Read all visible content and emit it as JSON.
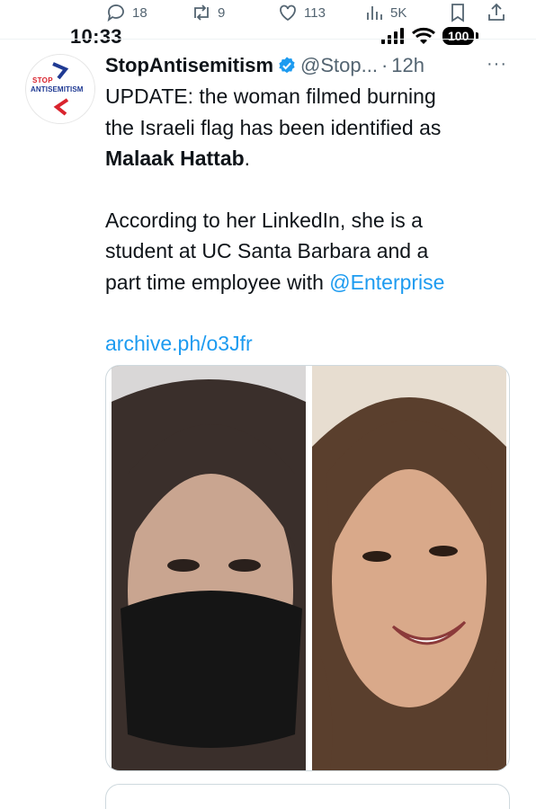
{
  "action_bar": {
    "reply_count": "18",
    "retweet_count": "9",
    "like_count": "113",
    "view_count": "5K",
    "icons": [
      "reply-icon",
      "retweet-icon",
      "heart-icon",
      "views-icon",
      "bookmark-icon",
      "share-icon"
    ]
  },
  "status_bar": {
    "time": "10:33",
    "battery": "100"
  },
  "tweet": {
    "author_name": "StopAntisemitism",
    "handle": "@Stop...",
    "separator": "·",
    "time_ago": "12h",
    "more": "···",
    "avatar": {
      "logo_line1": "STOP",
      "logo_line2": "ANTISEMITISM"
    },
    "text": {
      "line1": "UPDATE: the woman filmed burning",
      "line2": "the Israeli flag has been identified as",
      "bold_name": "Malaak Hattab",
      "bold_suffix": ".",
      "line4": "According to her LinkedIn, she is a",
      "line5": "student at UC Santa Barbara and a",
      "line6_prefix": "part time employee with ",
      "mention": "@Enterprise",
      "link": "archive.ph/o3Jfr"
    }
  },
  "colors": {
    "link": "#1d9bf0",
    "secondary_text": "#536471",
    "verified_badge": "#1d9bf0",
    "border": "#cfd9de"
  }
}
